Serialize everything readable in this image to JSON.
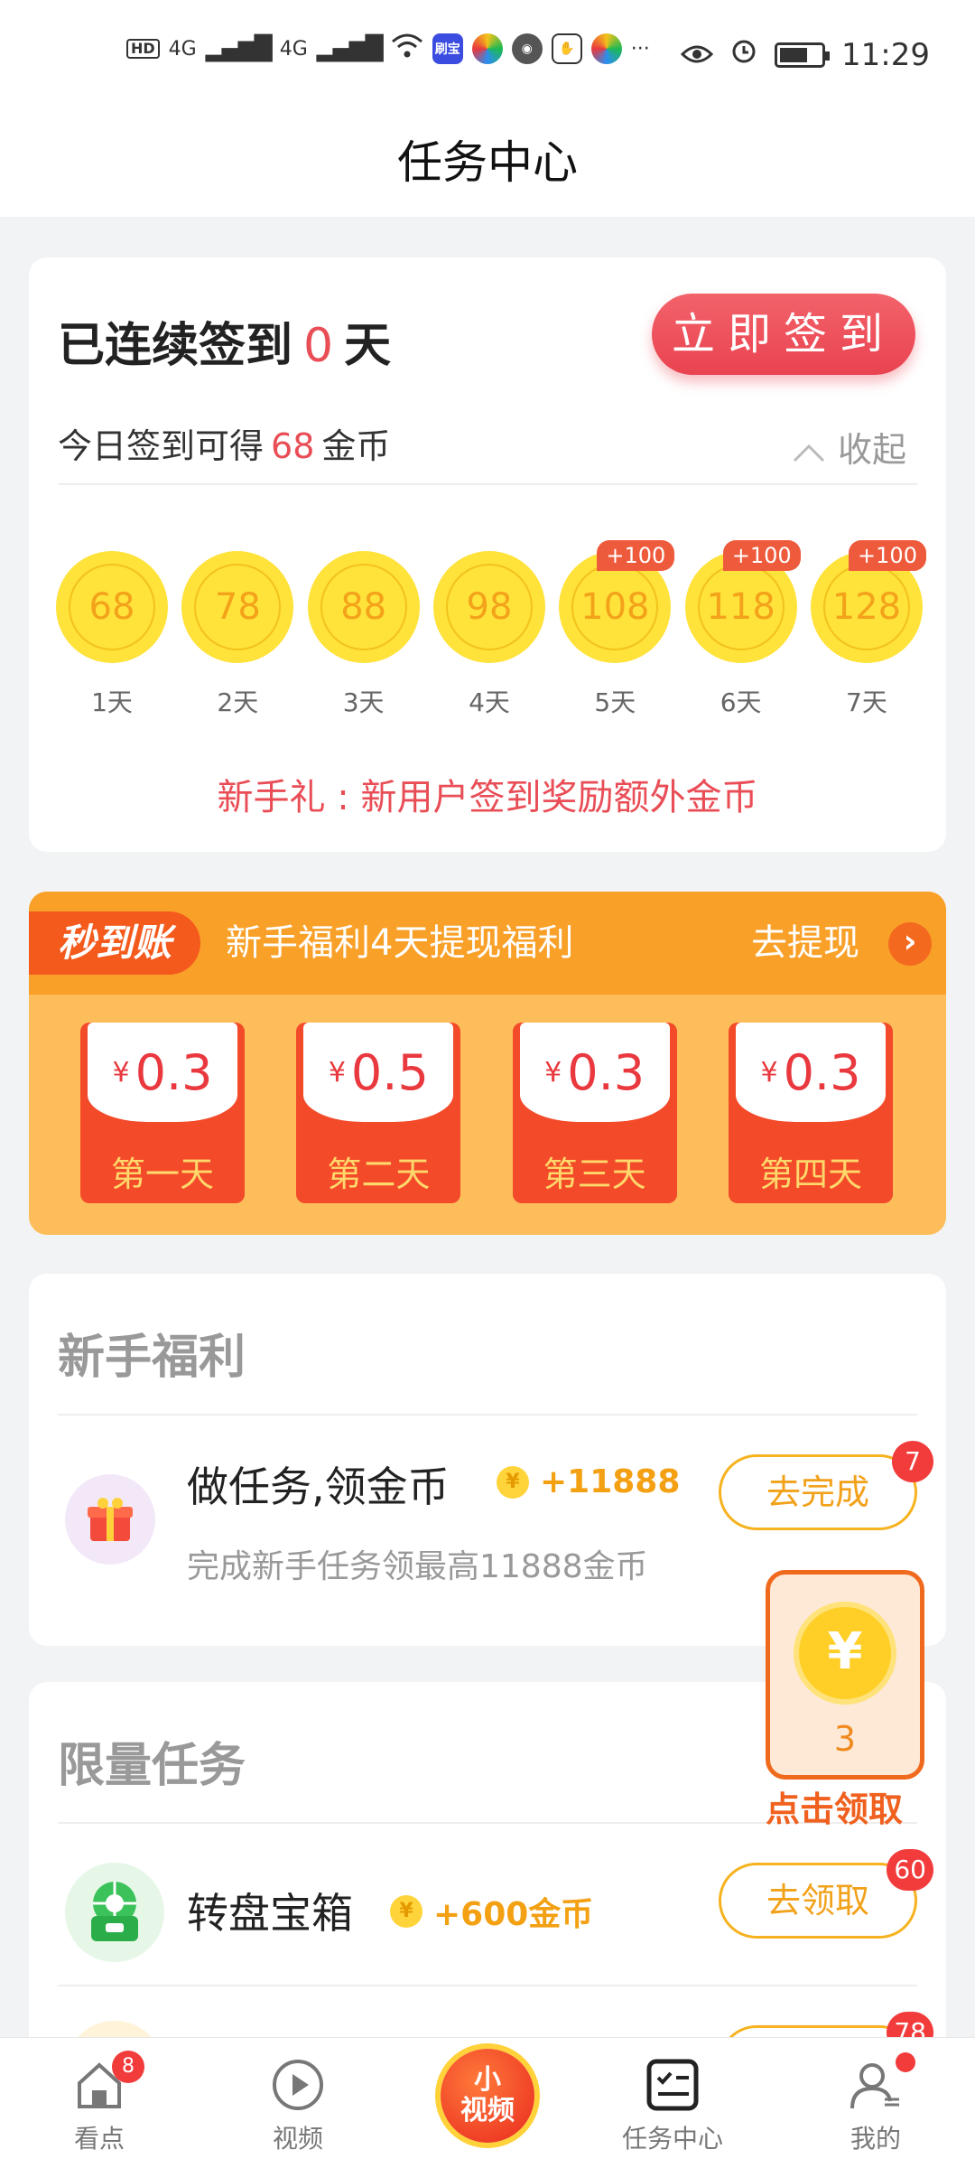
{
  "status_bar": {
    "left_indicators": [
      "HD",
      "4G",
      "4G"
    ],
    "app_icons": [
      "刷宝"
    ],
    "more": "···",
    "time": "11:29"
  },
  "header": {
    "title": "任务中心"
  },
  "checkin": {
    "streak_prefix": "已连续签到",
    "streak_days": "0",
    "streak_suffix": "天",
    "sign_button": "立即签到",
    "today_prefix": "今日签到可得",
    "today_coins": "68",
    "today_suffix": "金币",
    "collapse_label": "收起",
    "days": [
      {
        "coins": "68",
        "label": "1天",
        "bonus": ""
      },
      {
        "coins": "78",
        "label": "2天",
        "bonus": ""
      },
      {
        "coins": "88",
        "label": "3天",
        "bonus": ""
      },
      {
        "coins": "98",
        "label": "4天",
        "bonus": ""
      },
      {
        "coins": "108",
        "label": "5天",
        "bonus": "+100"
      },
      {
        "coins": "118",
        "label": "6天",
        "bonus": "+100"
      },
      {
        "coins": "128",
        "label": "7天",
        "bonus": "+100"
      }
    ],
    "new_user_note": "新手礼 : 新用户签到奖励额外金币"
  },
  "withdraw": {
    "tag": "秒到账",
    "title": "新手福利4天提现福利",
    "link": "去提现",
    "currency": "¥",
    "envelopes": [
      {
        "amount": "0.3",
        "label": "第一天"
      },
      {
        "amount": "0.5",
        "label": "第二天"
      },
      {
        "amount": "0.3",
        "label": "第三天"
      },
      {
        "amount": "0.3",
        "label": "第四天"
      }
    ]
  },
  "newbie": {
    "section_title": "新手福利",
    "task_title": "做任务,领金币",
    "reward": "+11888",
    "description": "完成新手任务领最高11888金币",
    "button": "去完成",
    "badge": "7"
  },
  "limited": {
    "section_title": "限量任务",
    "task_title": "转盘宝箱",
    "reward": "+600金币",
    "button": "去领取",
    "badge": "60",
    "next_badge": "78"
  },
  "claim_widget": {
    "count": "3",
    "label": "点击领取"
  },
  "bottom_nav": {
    "items": [
      {
        "label": "看点",
        "badge": "8"
      },
      {
        "label": "视频",
        "badge": ""
      },
      {
        "label": "小视频",
        "badge": ""
      },
      {
        "label": "任务中心",
        "badge": ""
      },
      {
        "label": "我的",
        "badge": ""
      }
    ],
    "center_text_top": "小",
    "center_text_bottom": "视频"
  }
}
